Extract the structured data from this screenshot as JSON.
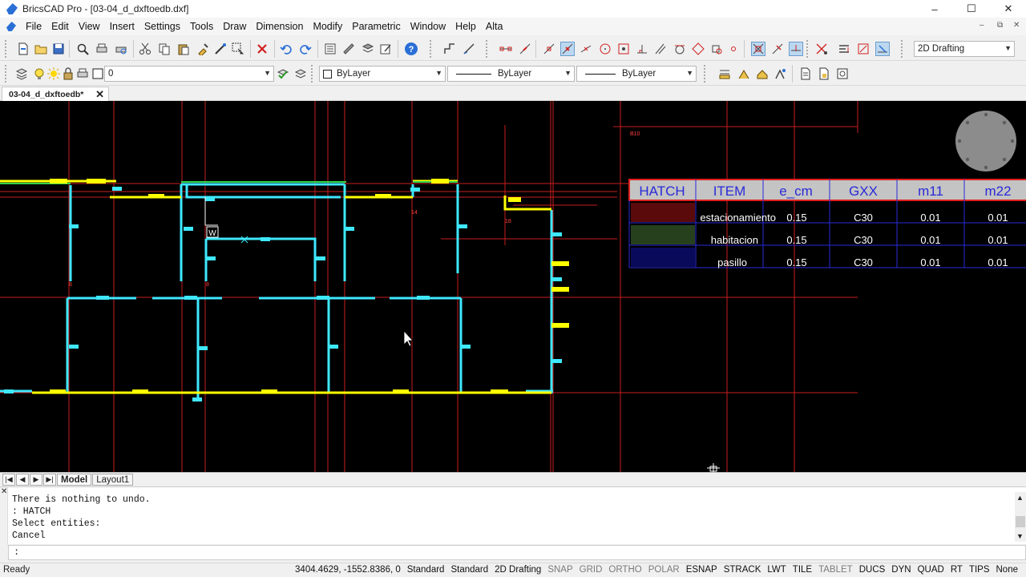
{
  "window": {
    "title": "BricsCAD Pro - [03-04_d_dxftoedb.dxf]",
    "minimize_glyph": "–",
    "maximize_glyph": "☐",
    "close_glyph": "✕"
  },
  "menu": [
    "File",
    "Edit",
    "View",
    "Insert",
    "Settings",
    "Tools",
    "Draw",
    "Dimension",
    "Modify",
    "Parametric",
    "Window",
    "Help",
    "Alta"
  ],
  "mdi_controls": [
    "–",
    "⧉",
    "✕"
  ],
  "workspace": {
    "label": "2D Drafting"
  },
  "layer_bar": {
    "layer_name": "0",
    "color": "ByLayer",
    "linetype": "ByLayer",
    "lineweight": "ByLayer"
  },
  "document_tab": {
    "label": "03-04_d_dxftoedb*",
    "close": "✕"
  },
  "drawing": {
    "colors": {
      "background": "#000000",
      "grid_red": "#c81e1e",
      "wall_cyan": "#3ee8ff",
      "wall_yellow": "#ffff00",
      "wall_green": "#32d24a",
      "table_blue": "#2a2ad8",
      "table_header": "#c4c4c4"
    },
    "labels": {
      "w_marker": "W",
      "small_tags": [
        "B10",
        "14",
        "18",
        "8",
        "8"
      ]
    },
    "hatch_table": {
      "headers": [
        "HATCH",
        "ITEM",
        "e_cm",
        "GXX",
        "m11",
        "m22"
      ],
      "rows": [
        {
          "swatch": "#5a0a0a",
          "item": "estacionamiento",
          "e_cm": "0.15",
          "gxx": "C30",
          "m11": "0.01",
          "m22": "0.01"
        },
        {
          "swatch": "#26401e",
          "item": "habitacion",
          "e_cm": "0.15",
          "gxx": "C30",
          "m11": "0.01",
          "m22": "0.01"
        },
        {
          "swatch": "#0a0a5a",
          "item": "pasillo",
          "e_cm": "0.15",
          "gxx": "C30",
          "m11": "0.01",
          "m22": "0.01"
        }
      ]
    }
  },
  "layout_tabs": {
    "nav": [
      "|◀",
      "◀",
      "▶",
      "▶|"
    ],
    "tabs": [
      "Model",
      "Layout1"
    ]
  },
  "command_history": [
    "There is nothing to undo.",
    ": HATCH",
    "Select entities:",
    "Cancel"
  ],
  "command_prompt": ":",
  "status": {
    "ready": "Ready",
    "coords": "3404.4629, -1552.8386, 0",
    "items": [
      {
        "label": "Standard",
        "on": true
      },
      {
        "label": "Standard",
        "on": true
      },
      {
        "label": "2D Drafting",
        "on": true
      },
      {
        "label": "SNAP",
        "on": false
      },
      {
        "label": "GRID",
        "on": false
      },
      {
        "label": "ORTHO",
        "on": false
      },
      {
        "label": "POLAR",
        "on": false
      },
      {
        "label": "ESNAP",
        "on": true
      },
      {
        "label": "STRACK",
        "on": true
      },
      {
        "label": "LWT",
        "on": true
      },
      {
        "label": "TILE",
        "on": true
      },
      {
        "label": "TABLET",
        "on": false
      },
      {
        "label": "DUCS",
        "on": true
      },
      {
        "label": "DYN",
        "on": true
      },
      {
        "label": "QUAD",
        "on": true
      },
      {
        "label": "RT",
        "on": true
      },
      {
        "label": "TIPS",
        "on": true
      },
      {
        "label": "None",
        "on": true
      }
    ]
  }
}
